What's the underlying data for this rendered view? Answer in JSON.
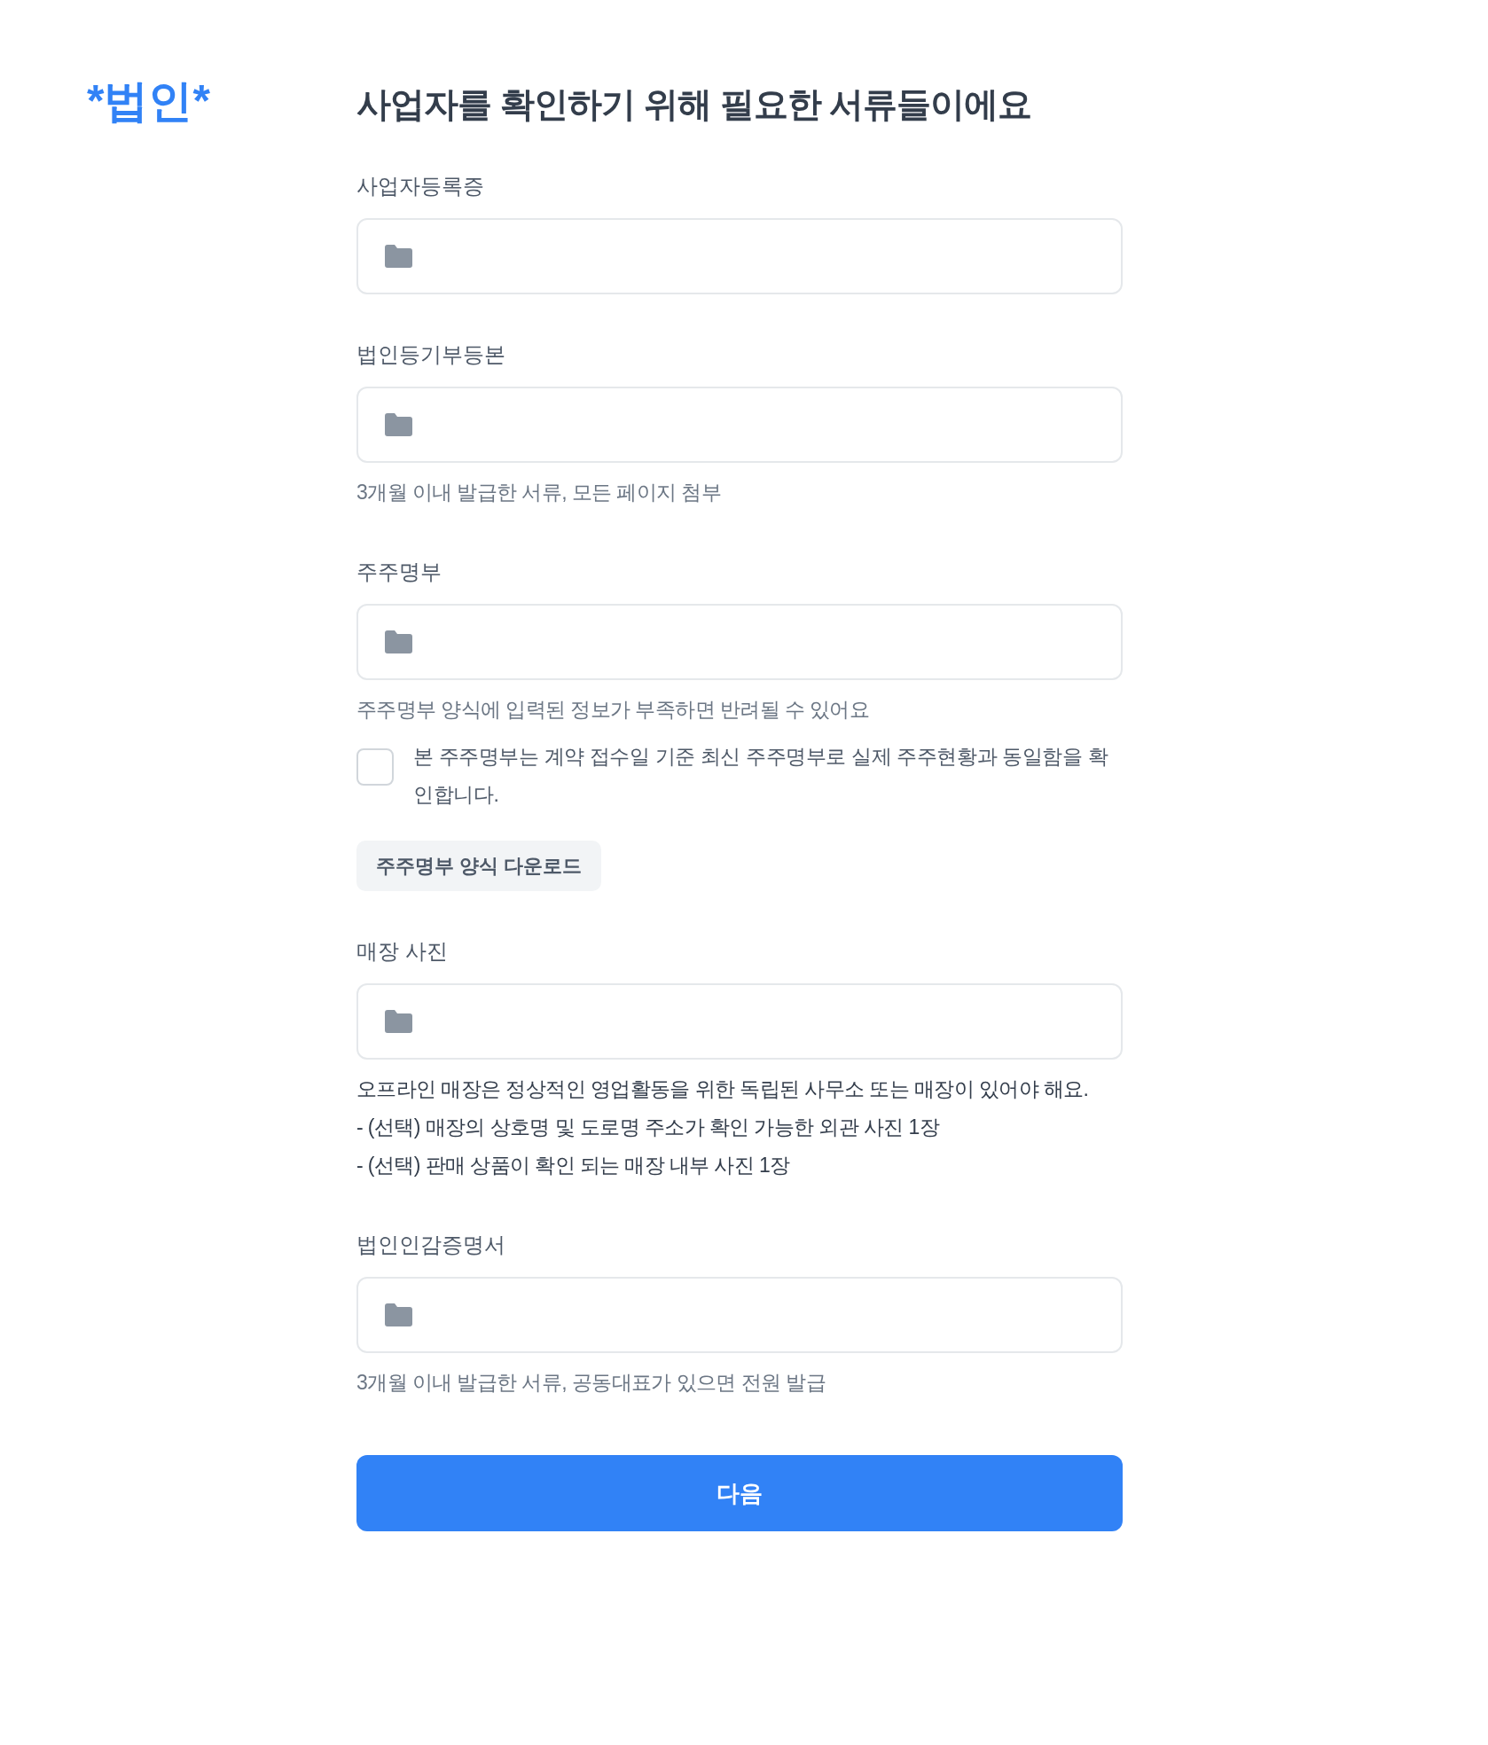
{
  "logo": "*법인*",
  "title": "사업자를 확인하기 위해 필요한 서류들이에요",
  "sections": [
    {
      "label": "사업자등록증"
    },
    {
      "label": "법인등기부등본",
      "hints": [
        "3개월 이내 발급한 서류, 모든 페이지 첨부"
      ],
      "hints_emphasized": false
    },
    {
      "label": "주주명부",
      "hints": [
        "주주명부 양식에 입력된 정보가 부족하면 반려될 수 있어요"
      ],
      "hints_emphasized": false,
      "checkbox": {
        "label": "본 주주명부는 계약 접수일 기준 최신 주주명부로 실제 주주현황과 동일함을 확인합니다.",
        "checked": false
      },
      "download_button": "주주명부 양식 다운로드"
    },
    {
      "label": "매장 사진",
      "hints": [
        "오프라인 매장은 정상적인 영업활동을 위한 독립된 사무소 또는 매장이 있어야 해요.",
        "- (선택) 매장의 상호명 및 도로명 주소가 확인 가능한 외관 사진 1장",
        "- (선택) 판매 상품이 확인 되는 매장 내부 사진 1장"
      ],
      "hints_emphasized": true
    },
    {
      "label": "법인인감증명서",
      "hints": [
        "3개월 이내 발급한 서류, 공동대표가 있으면 전원 발급"
      ],
      "hints_emphasized": false
    }
  ],
  "next_button": "다음"
}
